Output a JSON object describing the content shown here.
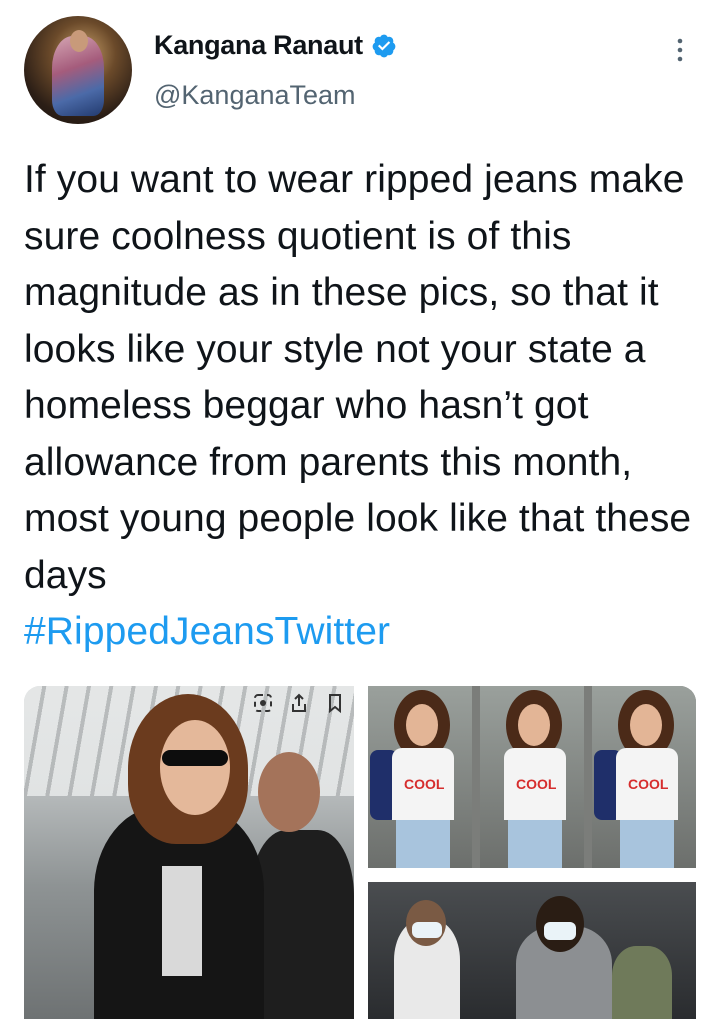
{
  "author": {
    "display_name": "Kangana Ranaut",
    "handle": "@KanganaTeam",
    "verified": true
  },
  "tweet": {
    "text": "If you want to wear ripped jeans make sure coolness quotient is of this magnitude as in these pics, so that it looks like your style not your state a homeless beggar who hasn’t got allowance from parents this month, most young people look like that these days",
    "hashtag": "#RippedJeansTwitter"
  },
  "media": {
    "photos": [
      {
        "id": "photo-1",
        "tee_text": ""
      },
      {
        "id": "photo-2",
        "tee_text": "COOL"
      },
      {
        "id": "photo-3",
        "tee_text": ""
      }
    ]
  },
  "icons": {
    "more": "more-vertical-icon",
    "verified": "verified-badge-icon"
  },
  "colors": {
    "accent": "#1d9bf0",
    "text": "#0f1419",
    "secondary": "#536471"
  }
}
